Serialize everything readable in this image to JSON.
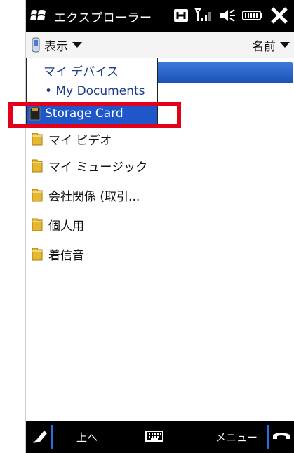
{
  "title_bar": {
    "title": "エクスプローラー",
    "icons": [
      "windows-logo-icon",
      "h-icon",
      "signal-icon",
      "speaker-icon",
      "battery-icon",
      "close-icon"
    ]
  },
  "view_bar": {
    "view_label": "表示",
    "sort_label": "名前",
    "icons": [
      "phone-icon",
      "chevron-down-icon"
    ]
  },
  "dropdown": {
    "items": [
      {
        "label": "マイ デバイス"
      },
      {
        "label": "• My Documents"
      },
      {
        "label": "Storage Card",
        "selected": true
      }
    ]
  },
  "folders": [
    {
      "label": "マイ ビデオ"
    },
    {
      "label": "マイ ミュージック"
    },
    {
      "label": "会社関係 (取引..."
    },
    {
      "label": "個人用"
    },
    {
      "label": "着信音"
    }
  ],
  "bottom_bar": {
    "left_label": "上へ",
    "right_label": "メニュー",
    "icons": [
      "pen-icon",
      "keyboard-icon",
      "phone-hangup-icon"
    ]
  },
  "colors": {
    "highlight": "#e3001b",
    "selection": "#1f56c9",
    "folder": "#e6b830"
  }
}
